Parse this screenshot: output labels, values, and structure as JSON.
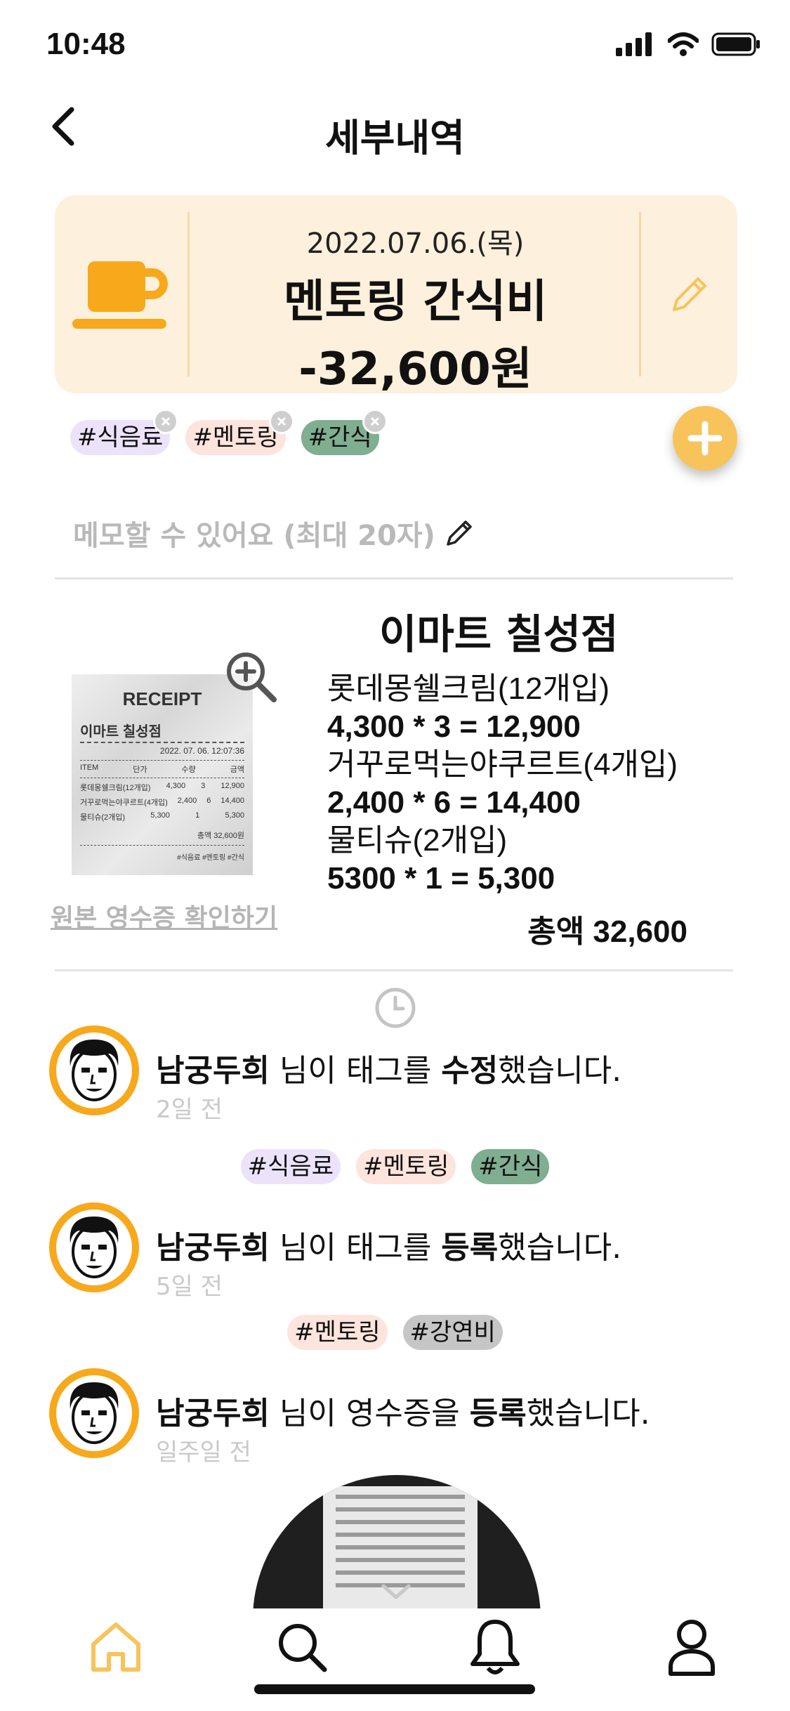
{
  "status_bar": {
    "time": "10:48"
  },
  "header": {
    "title": "세부내역"
  },
  "summary": {
    "date": "2022.07.06.(목)",
    "name": "멘토링 간식비",
    "amount": "-32,600원",
    "accent_color": "#f7a81b",
    "card_color": "#fdf0dc"
  },
  "tags": [
    {
      "label": "#식음료",
      "color": "#ece3fb"
    },
    {
      "label": "#멘토링",
      "color": "#fde4dc"
    },
    {
      "label": "#간식",
      "color": "#7fae91"
    }
  ],
  "memo": {
    "placeholder": "메모할 수 있어요 (최대 20자)"
  },
  "receipt": {
    "image": {
      "title": "RECEIPT",
      "store": "이마트 칠성점",
      "datetime": "2022. 07. 06. 12:07:36",
      "columns": [
        "ITEM",
        "단가",
        "수량",
        "금액"
      ],
      "rows": [
        [
          "롯데몽쉘크림(12개입)",
          "4,300",
          "3",
          "12,900"
        ],
        [
          "거꾸로먹는야쿠르트(4개입)",
          "2,400",
          "6",
          "14,400"
        ],
        [
          "물티슈(2개입)",
          "5,300",
          "1",
          "5,300"
        ]
      ],
      "total": "총액 32,600원",
      "tags": "#식음료   #멘토링   #간식"
    },
    "link_label": "원본 영수증 확인하기",
    "store_name": "이마트 칠성점",
    "items": [
      {
        "name": "롯데몽쉘크림(12개입)",
        "formula": "4,300 * 3 = 12,900"
      },
      {
        "name": "거꾸로먹는야쿠르트(4개입)",
        "formula": "2,400 * 6 = 14,400"
      },
      {
        "name": "물티슈(2개입)",
        "formula": "5300 * 1 = 5,300"
      }
    ],
    "total": "총액 32,600"
  },
  "timeline": [
    {
      "user": "남궁두희",
      "middle": " 님이 태그를 ",
      "action": "수정",
      "suffix": "했습니다.",
      "time": "2일 전",
      "tags": [
        {
          "label": "#식음료",
          "color": "#ece3fb"
        },
        {
          "label": "#멘토링",
          "color": "#fde4dc"
        },
        {
          "label": "#간식",
          "color": "#7fae91"
        }
      ]
    },
    {
      "user": "남궁두희",
      "middle": " 님이 태그를 ",
      "action": "등록",
      "suffix": "했습니다.",
      "time": "5일 전",
      "tags": [
        {
          "label": "#멘토링",
          "color": "#fde4dc"
        },
        {
          "label": "#강연비",
          "color": "#c6c6c6"
        }
      ]
    },
    {
      "user": "남궁두희",
      "middle": " 님이 영수증을 ",
      "action": "등록",
      "suffix": "했습니다.",
      "time": "일주일 전",
      "tags": []
    }
  ],
  "tab_bar": {
    "items": [
      {
        "icon": "home-icon",
        "active": true
      },
      {
        "icon": "search-icon",
        "active": false
      },
      {
        "icon": "bell-icon",
        "active": false
      },
      {
        "icon": "profile-icon",
        "active": false
      }
    ],
    "active_color": "#f7c35a"
  }
}
